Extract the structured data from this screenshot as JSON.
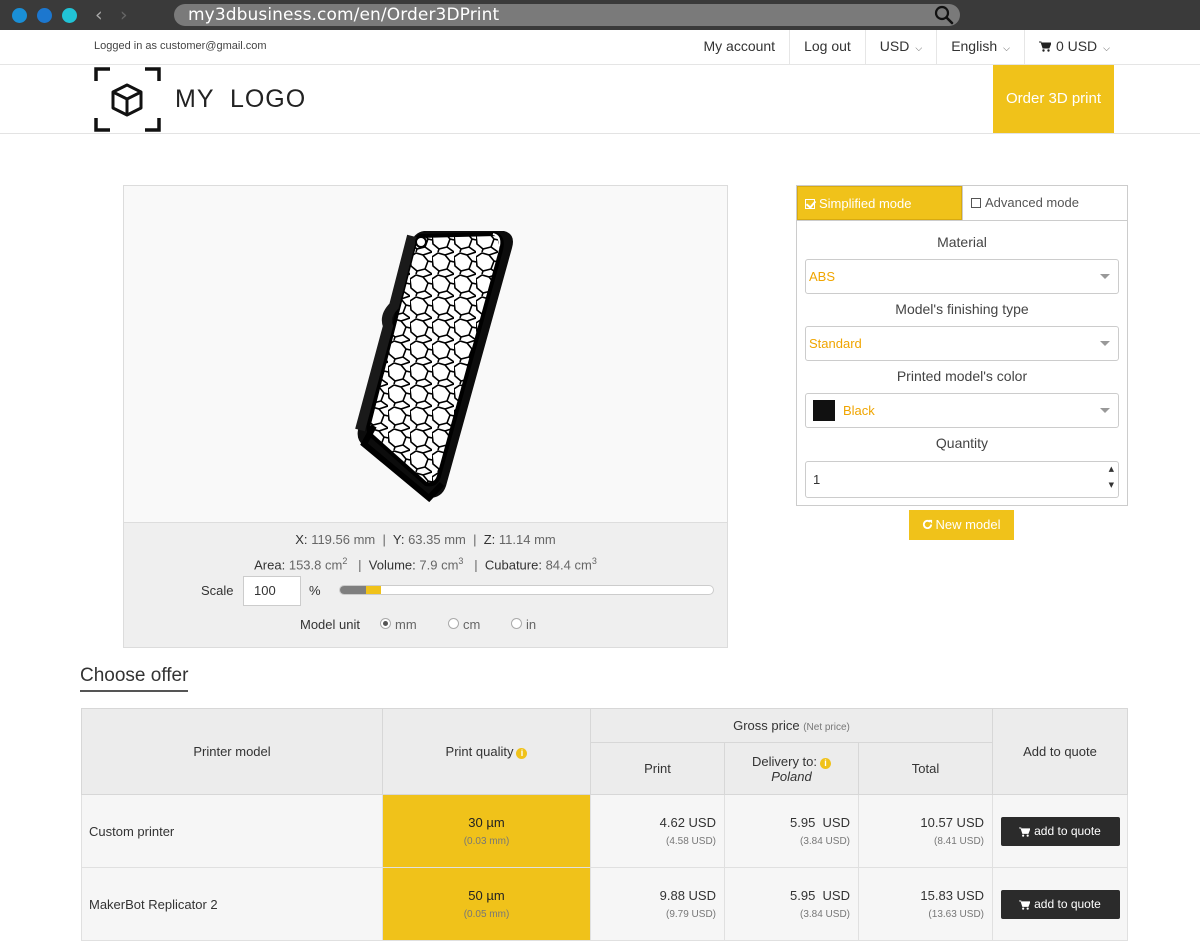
{
  "browser": {
    "url": "my3dbusiness.com/en/Order3DPrint",
    "back_icon": "chevron-left-icon",
    "forward_icon": "chevron-right-icon",
    "search_icon": "magnifier-icon"
  },
  "topbar": {
    "logged_in": "Logged in as customer@gmail.com",
    "my_account": "My account",
    "log_out": "Log out",
    "currency": "USD",
    "language": "English",
    "cart": "0 USD"
  },
  "header": {
    "logo_text": "MY  LOGO",
    "order_button": "Order 3D print"
  },
  "viewer": {
    "dims": {
      "x_label": "X:",
      "x_value": "119.56 mm",
      "y_label": "Y:",
      "y_value": "63.35 mm",
      "z_label": "Z:",
      "z_value": "11.14 mm",
      "area_label": "Area:",
      "area_value": "153.8 cm",
      "volume_label": "Volume:",
      "volume_value": "7.9 cm",
      "cubature_label": "Cubature:",
      "cubature_value": "84.4 cm",
      "sup2": "2",
      "sup3": "3"
    },
    "scale_label": "Scale",
    "scale_value": "100",
    "scale_unit": "%",
    "scale_progress": {
      "gray_fraction": 0.07,
      "yellow_fraction": 0.04
    },
    "model_unit_label": "Model unit",
    "units": [
      {
        "label": "mm",
        "selected": true
      },
      {
        "label": "cm",
        "selected": false
      },
      {
        "label": "in",
        "selected": false
      }
    ]
  },
  "config": {
    "tab_simplified": "Simplified mode",
    "tab_advanced": "Advanced mode",
    "material_label": "Material",
    "material_value": "ABS",
    "finishing_label": "Model's finishing type",
    "finishing_value": "Standard",
    "color_label": "Printed model's color",
    "color_value": "Black",
    "quantity_label": "Quantity",
    "quantity_value": "1",
    "new_model": "New model",
    "accent_color": "#f0c21a"
  },
  "offer": {
    "title": "Choose offer",
    "headers": {
      "printer_model": "Printer model",
      "print_quality": "Print quality",
      "gross_price": "Gross price",
      "net_price": "(Net price)",
      "print": "Print",
      "delivery": "Delivery to:",
      "delivery_country": "Poland",
      "total": "Total",
      "add_to_quote": "Add to quote"
    },
    "rows": [
      {
        "printer": "Custom printer",
        "quality": "30 µm",
        "quality_mm": "(0.03 mm)",
        "print": "4.62 USD",
        "print_net": "(4.58 USD)",
        "delivery": "5.95  USD",
        "delivery_net": "(3.84 USD)",
        "total": "10.57 USD",
        "total_net": "(8.41 USD)",
        "button": "add to quote"
      },
      {
        "printer": "MakerBot Replicator 2",
        "quality": "50 µm",
        "quality_mm": "(0.05 mm)",
        "print": "9.88 USD",
        "print_net": "(9.79 USD)",
        "delivery": "5.95  USD",
        "delivery_net": "(3.84 USD)",
        "total": "15.83 USD",
        "total_net": "(13.63 USD)",
        "button": "add to quote"
      }
    ]
  }
}
